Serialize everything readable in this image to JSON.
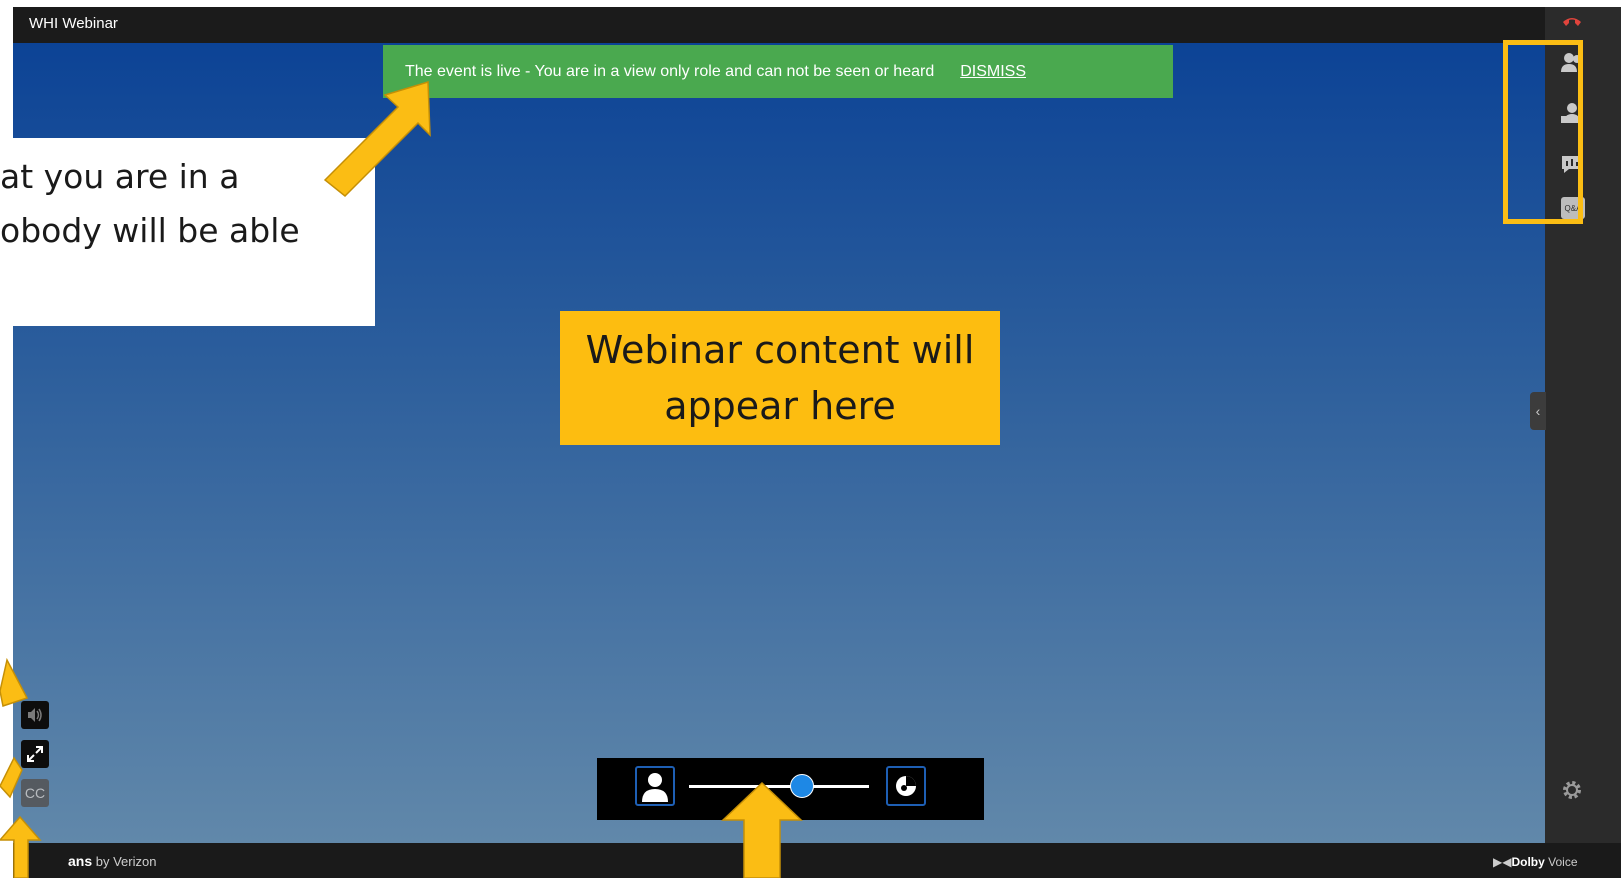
{
  "window": {
    "title": "WHI Webinar"
  },
  "banner": {
    "message": "The event is live - You are in a view only role and can not be seen or heard",
    "dismiss_label": "DISMISS",
    "color": "#4aa94f"
  },
  "callout": {
    "line1": "at you are in a",
    "line2": "obody will be able"
  },
  "content_box": {
    "line1": "Webinar content will",
    "line2": "appear here",
    "color": "#fdbd10"
  },
  "sidebar": {
    "icons": [
      "hang-up-icon",
      "participants-icon",
      "presenter-icon",
      "chat-icon",
      "qa-icon",
      "settings-icon"
    ],
    "qa_label": "Q&A"
  },
  "controls": {
    "icons": [
      "speaker-icon",
      "fullscreen-icon"
    ],
    "cc_label": "CC"
  },
  "layout_slider": {
    "left_icon": "person-view-icon",
    "right_icon": "content-view-icon"
  },
  "footer": {
    "brand_bold": "ans",
    "brand_suffix": " by Verizon",
    "dolby_bold": "Dolby",
    "dolby_suffix": " Voice"
  },
  "annotation_color": "#fbbd14"
}
